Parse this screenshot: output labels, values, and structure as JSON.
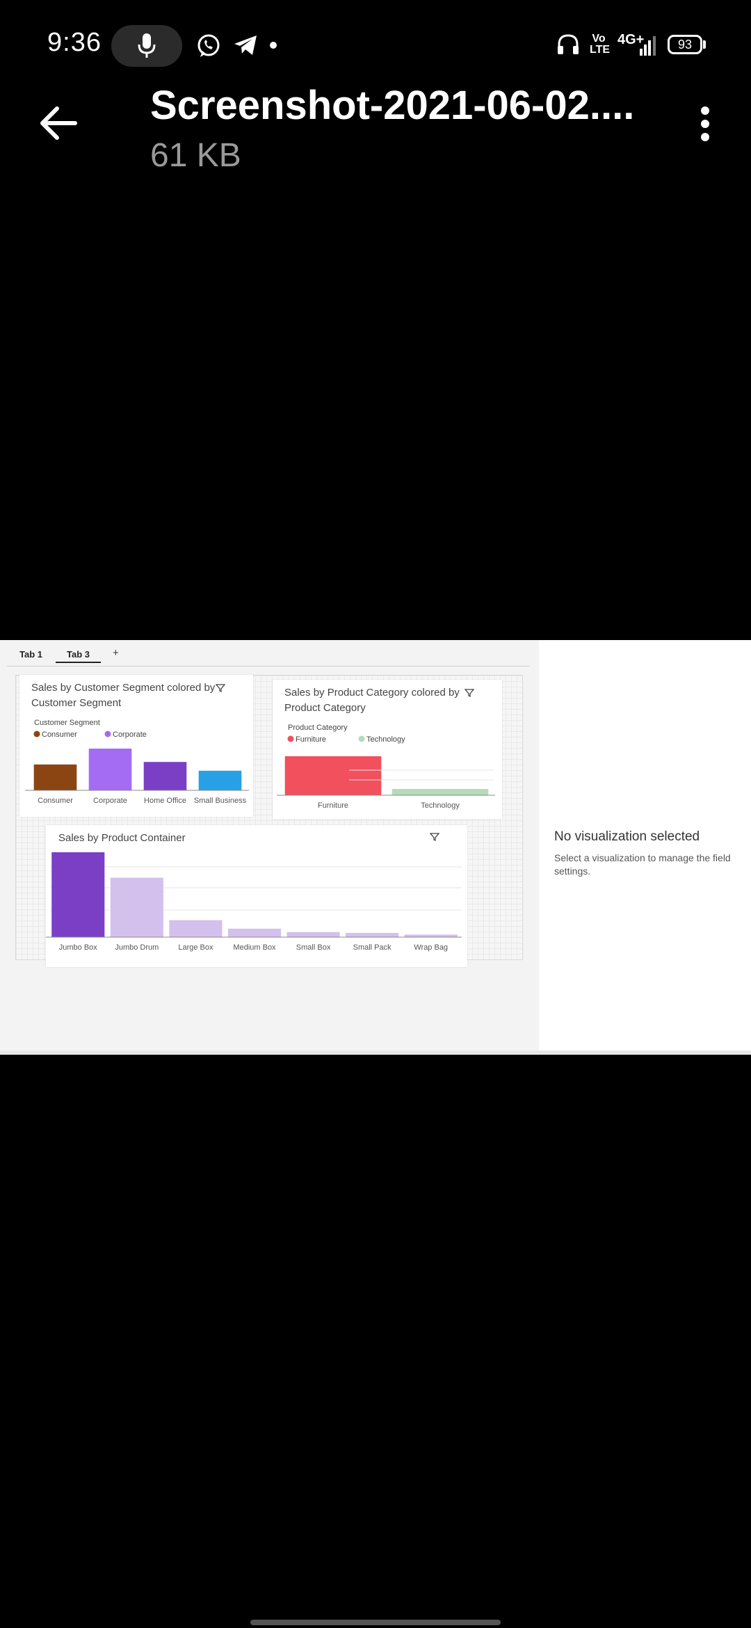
{
  "status_bar": {
    "time": "9:36",
    "network": "4G+",
    "volte": "Vo LTE",
    "battery": "93"
  },
  "app_bar": {
    "title": "Screenshot-2021-06-02....",
    "subtitle": "61 KB"
  },
  "dashboard": {
    "tabs": [
      {
        "label": "Tab 1",
        "active": false
      },
      {
        "label": "Tab 3",
        "active": true
      }
    ],
    "add_tab": "+",
    "panel": {
      "title": "No visualization selected",
      "description": "Select a visualization to manage the field settings."
    }
  },
  "chart_data": [
    {
      "type": "bar",
      "title": "Sales by Customer Segment colored by Customer Segment",
      "legend_title": "Customer Segment",
      "legend": [
        "Consumer",
        "Corporate"
      ],
      "categories": [
        "Consumer",
        "Corporate",
        "Home Office",
        "Small Business"
      ],
      "values": [
        0.62,
        1.0,
        0.68,
        0.47
      ],
      "colors": [
        "#8b4513",
        "#a46cf2",
        "#7b3fc6",
        "#27a0e6"
      ]
    },
    {
      "type": "bar",
      "title": "Sales by Product Category colored by Product Category",
      "legend_title": "Product Category",
      "legend": [
        "Furniture",
        "Technology"
      ],
      "categories": [
        "Furniture",
        "Technology"
      ],
      "values": [
        1.0,
        0.16
      ],
      "colors": [
        "#f1505c",
        "#b5dcb9"
      ]
    },
    {
      "type": "bar",
      "title": "Sales by Product Container",
      "categories": [
        "Jumbo Box",
        "Jumbo Drum",
        "Large Box",
        "Medium Box",
        "Small Box",
        "Small Pack",
        "Wrap Bag"
      ],
      "values": [
        1.0,
        0.7,
        0.2,
        0.1,
        0.06,
        0.05,
        0.03
      ],
      "colors": [
        "#7b3fc6",
        "#d4c0ec",
        "#d4c0ec",
        "#d4c0ec",
        "#d4c0ec",
        "#d4c0ec",
        "#d4c0ec"
      ]
    }
  ]
}
